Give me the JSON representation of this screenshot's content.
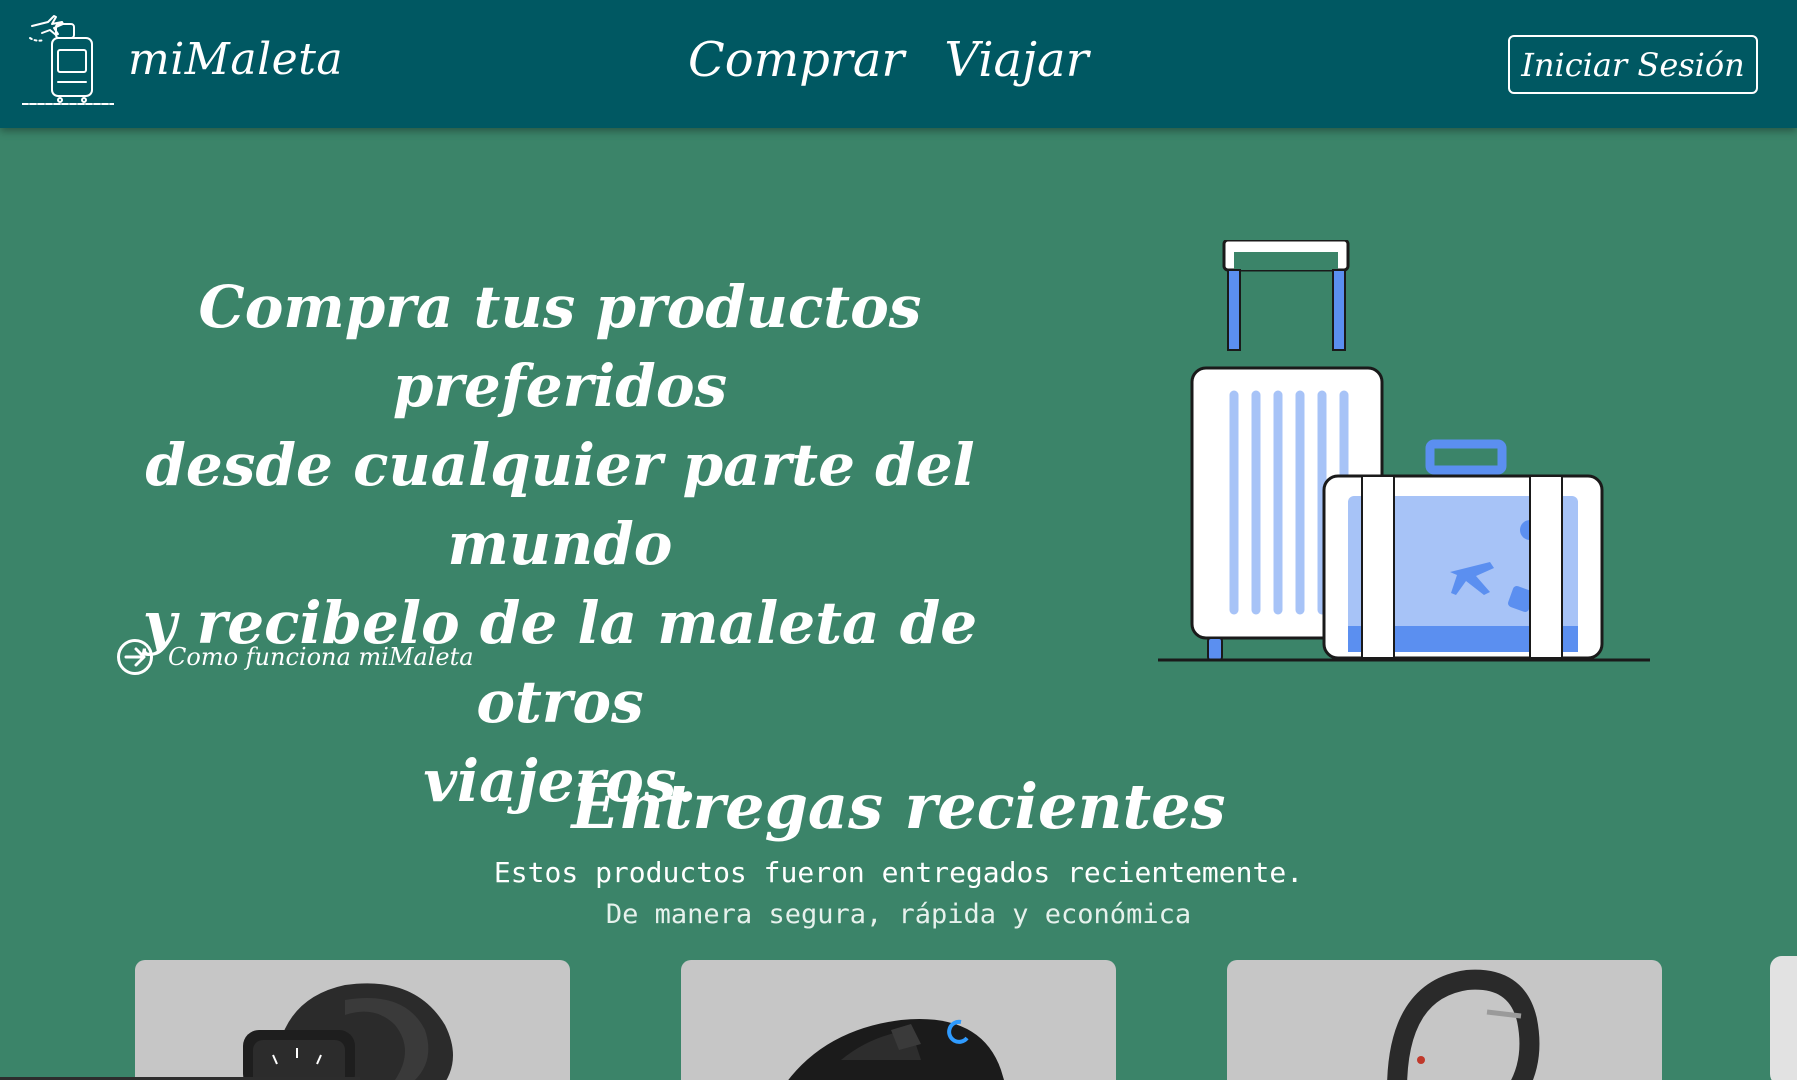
{
  "header": {
    "brand": "miMaleta",
    "logo_icon": "suitcase-airplane-icon",
    "nav": [
      {
        "label": "Comprar"
      },
      {
        "label": "Viajar"
      }
    ],
    "login_label": "Iniciar Sesión"
  },
  "hero": {
    "title_lines": [
      "Compra tus productos preferidos",
      "desde cualquier parte del mundo",
      "y recibelo de la maleta de otros",
      "viajeros."
    ],
    "how_link_icon": "arrow-right-circle-icon",
    "how_link_label": "Como funciona miMaleta",
    "illustration": "suitcases-illustration"
  },
  "recent": {
    "title": "Entregas recientes",
    "subtitle": "Estos productos fueron entregados recientemente.",
    "subtitle2": "De manera segura, rápida y económica",
    "products": [
      {
        "image": "smartwatch-image"
      },
      {
        "image": "gaming-mouse-image"
      },
      {
        "image": "fitness-band-image"
      }
    ]
  },
  "colors": {
    "navbar": "#005862",
    "background": "#3b8469",
    "accent_blue": "#5b8ff0",
    "card": "#c6c6c6"
  }
}
